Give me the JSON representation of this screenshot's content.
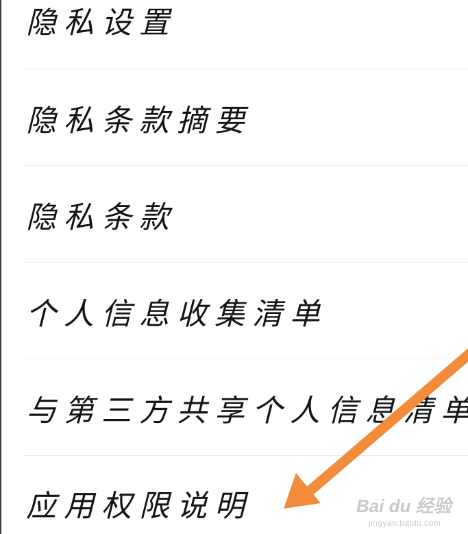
{
  "settings_list": {
    "items": [
      {
        "label": "隐私设置"
      },
      {
        "label": "隐私条款摘要"
      },
      {
        "label": "隐私条款"
      },
      {
        "label": "个人信息收集清单"
      },
      {
        "label": "与第三方共享个人信息清单"
      },
      {
        "label": "应用权限说明"
      }
    ]
  },
  "annotation": {
    "arrow_color": "#F28C3A"
  },
  "watermark": {
    "brand": "Bai du 经验",
    "url": "jingyan.baidu.com"
  }
}
